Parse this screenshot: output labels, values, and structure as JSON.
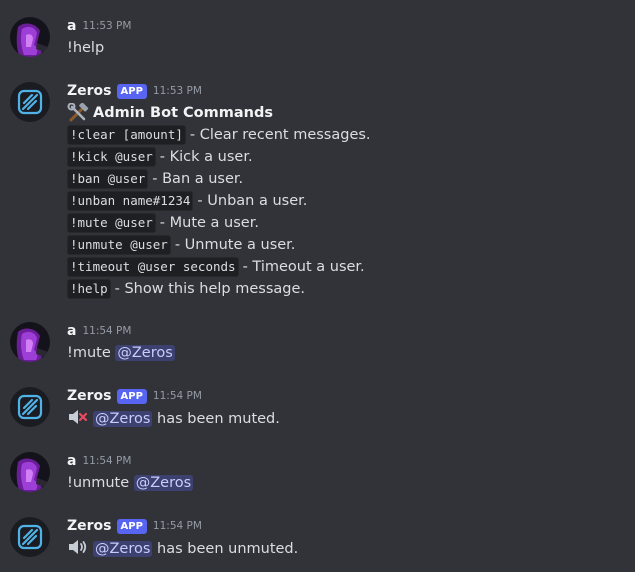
{
  "messages": [
    {
      "user": "a",
      "time": "11:53 PM",
      "text": "!help"
    },
    {
      "user": "Zeros",
      "badge": "APP",
      "time": "11:53 PM",
      "title": "Admin Bot Commands",
      "title_icon": "hammer-wrench-icon",
      "commands": [
        {
          "code": "!clear [amount]",
          "desc": "- Clear recent messages."
        },
        {
          "code": "!kick @user",
          "desc": "- Kick a user."
        },
        {
          "code": "!ban @user",
          "desc": "- Ban a user."
        },
        {
          "code": "!unban name#1234",
          "desc": "- Unban a user."
        },
        {
          "code": "!mute @user",
          "desc": "- Mute a user."
        },
        {
          "code": "!unmute @user",
          "desc": "- Unmute a user."
        },
        {
          "code": "!timeout @user seconds",
          "desc": "- Timeout a user."
        },
        {
          "code": "!help",
          "desc": "- Show this help message."
        }
      ]
    },
    {
      "user": "a",
      "time": "11:54 PM",
      "text": "!mute",
      "mention": "@Zeros"
    },
    {
      "user": "Zeros",
      "badge": "APP",
      "time": "11:54 PM",
      "icon": "muted-speaker-icon",
      "mention": "@Zeros",
      "text": "has been muted."
    },
    {
      "user": "a",
      "time": "11:54 PM",
      "text": "!unmute",
      "mention": "@Zeros"
    },
    {
      "user": "Zeros",
      "badge": "APP",
      "time": "11:54 PM",
      "icon": "speaker-icon",
      "mention": "@Zeros",
      "text": "has been unmuted."
    }
  ],
  "colors": {
    "background": "#323339",
    "app_badge": "#5865f2",
    "mention_bg": "#3c4270",
    "mention_text": "#c9cdfb",
    "user_avatar": "#7a2aa8",
    "bot_avatar": "#1a1c22",
    "bot_logo": "#4fb3e8"
  }
}
